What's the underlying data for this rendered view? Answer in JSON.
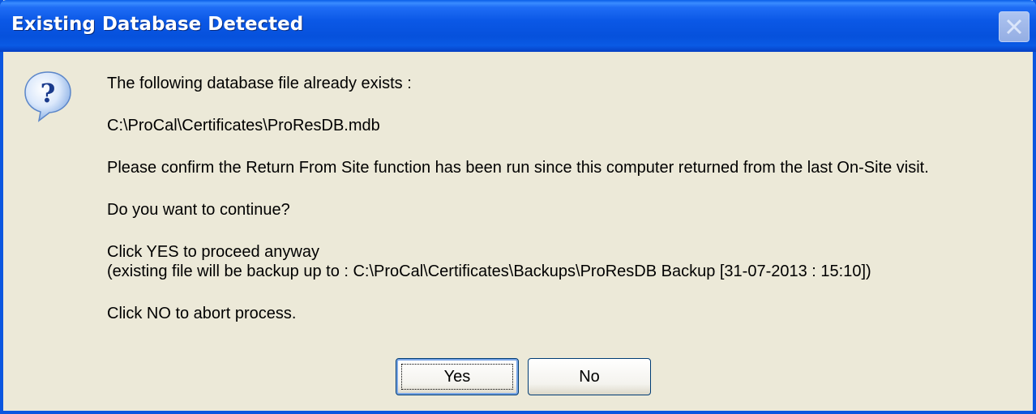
{
  "dialog": {
    "title": "Existing Database Detected",
    "icon": "question-icon",
    "messages": {
      "line1": "The following database file already exists :",
      "line2": "C:\\ProCal\\Certificates\\ProResDB.mdb",
      "line3": "Please confirm the Return From Site function has been run since this computer returned from the last On-Site visit.",
      "line4": "Do you want to continue?",
      "line5": "Click YES to proceed anyway",
      "line6": "(existing file will be backup up to : C:\\ProCal\\Certificates\\Backups\\ProResDB Backup [31-07-2013 : 15:10])",
      "line7": "Click NO to abort process."
    },
    "buttons": {
      "yes": "Yes",
      "no": "No"
    }
  },
  "colors": {
    "titlebar": "#0b58e6",
    "dialog_bg": "#ece9d8",
    "border": "#0b56e0"
  }
}
